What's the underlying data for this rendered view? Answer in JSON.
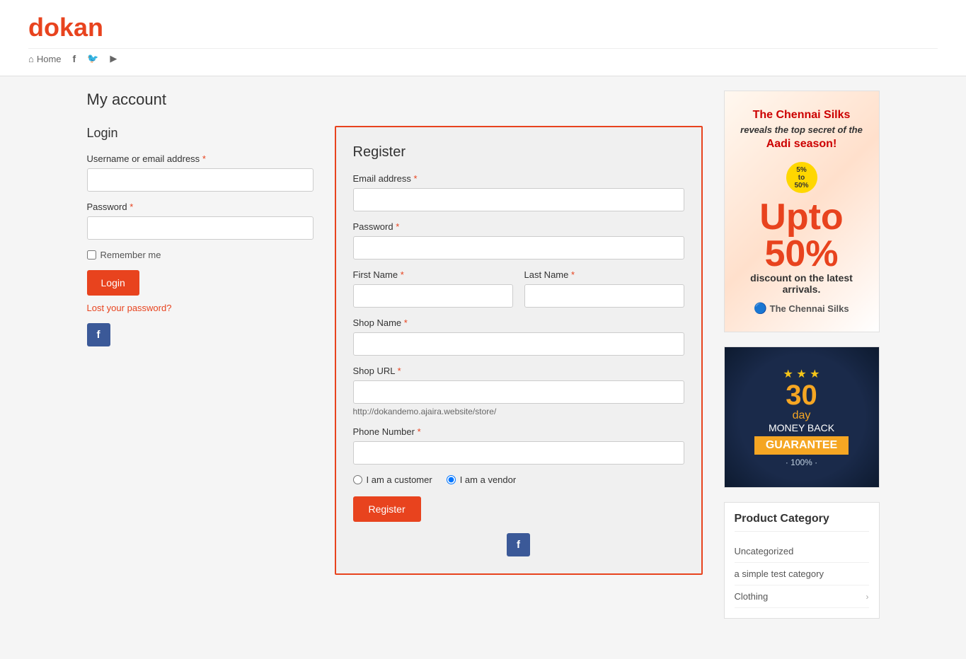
{
  "logo": {
    "letter_d": "d",
    "rest": "okan"
  },
  "nav": {
    "home_label": "Home",
    "icons": [
      "facebook",
      "twitter",
      "youtube"
    ]
  },
  "page_title": "My account",
  "login": {
    "section_title": "Login",
    "username_label": "Username or email address",
    "username_required": "*",
    "username_placeholder": "",
    "password_label": "Password",
    "password_required": "*",
    "password_placeholder": "",
    "remember_label": "Remember me",
    "login_button": "Login",
    "lost_password": "Lost your password?",
    "facebook_label": "f"
  },
  "register": {
    "section_title": "Register",
    "email_label": "Email address",
    "email_required": "*",
    "email_placeholder": "",
    "password_label": "Password",
    "password_required": "*",
    "password_placeholder": "",
    "first_name_label": "First Name",
    "first_name_required": "*",
    "first_name_placeholder": "",
    "last_name_label": "Last Name",
    "last_name_required": "*",
    "last_name_placeholder": "",
    "shop_name_label": "Shop Name",
    "shop_name_required": "*",
    "shop_name_placeholder": "",
    "shop_url_label": "Shop URL",
    "shop_url_required": "*",
    "shop_url_placeholder": "",
    "shop_url_hint": "http://dokandemo.ajaira.website/store/",
    "phone_label": "Phone Number",
    "phone_required": "*",
    "phone_placeholder": "",
    "radio_customer": "I am a customer",
    "radio_vendor": "I am a vendor",
    "register_button": "Register",
    "facebook_label": "f"
  },
  "sidebar": {
    "ad": {
      "headline1": "The Chennai Silks",
      "headline2": "reveals the top secret of the",
      "headline3": "Aadi season!",
      "discount": "50%",
      "discount_text": "discount on the latest arrivals.",
      "brand": "The Chennai Silks"
    },
    "guarantee": {
      "stars": "★ ★ ★",
      "days": "30",
      "day_label": "day",
      "money": "Money Back",
      "ribbon": "GUARANTEE",
      "pct": "· 100% ·"
    },
    "product_category": {
      "title": "Product Category",
      "items": [
        {
          "label": "Uncategorized",
          "has_arrow": false
        },
        {
          "label": "a simple test category",
          "has_arrow": false
        },
        {
          "label": "Clothing",
          "has_arrow": true
        }
      ]
    }
  }
}
